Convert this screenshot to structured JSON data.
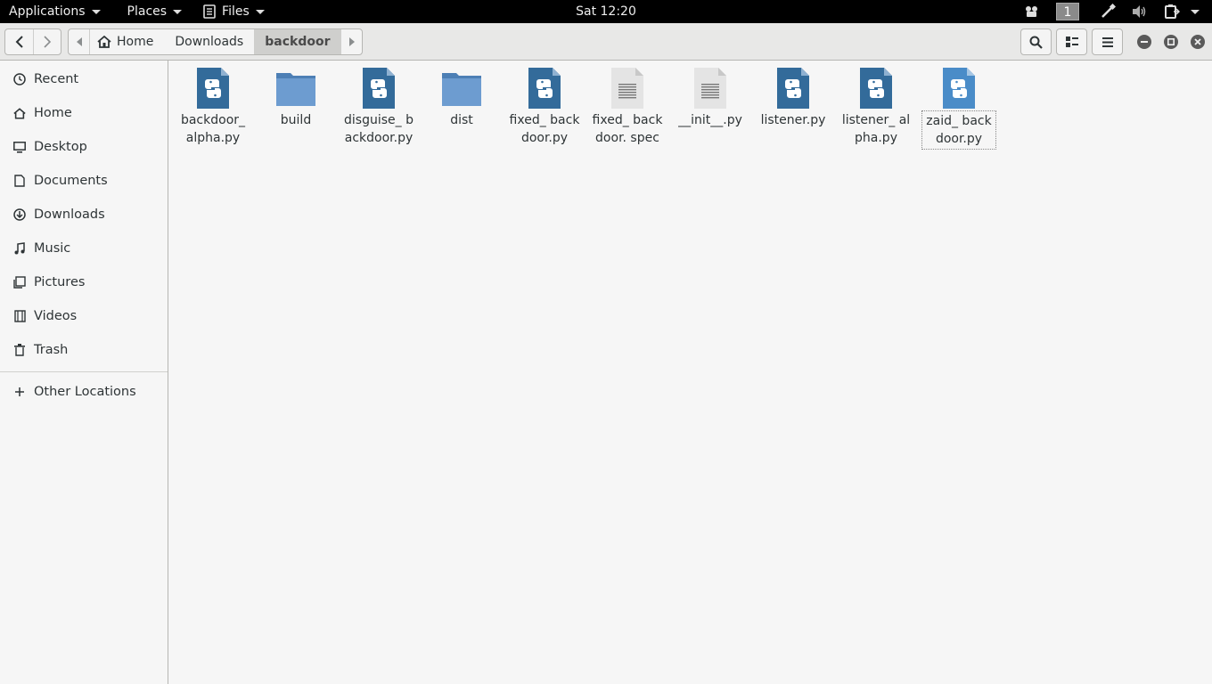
{
  "topbar": {
    "applications": "Applications",
    "places": "Places",
    "files": "Files",
    "clock": "Sat 12:20",
    "workspace": "1"
  },
  "path": {
    "home": "Home",
    "downloads": "Downloads",
    "current": "backdoor"
  },
  "sidebar": {
    "items": [
      {
        "label": "Recent",
        "icon": "clock-icon"
      },
      {
        "label": "Home",
        "icon": "home-icon"
      },
      {
        "label": "Desktop",
        "icon": "desktop-icon"
      },
      {
        "label": "Documents",
        "icon": "document-icon"
      },
      {
        "label": "Downloads",
        "icon": "download-icon"
      },
      {
        "label": "Music",
        "icon": "music-icon"
      },
      {
        "label": "Pictures",
        "icon": "pictures-icon"
      },
      {
        "label": "Videos",
        "icon": "video-icon"
      },
      {
        "label": "Trash",
        "icon": "trash-icon"
      }
    ],
    "other": "Other Locations"
  },
  "files": [
    {
      "name": "backdoor_ alpha.py",
      "type": "python"
    },
    {
      "name": "build",
      "type": "folder"
    },
    {
      "name": "disguise_ backdoor.py",
      "type": "python"
    },
    {
      "name": "dist",
      "type": "folder"
    },
    {
      "name": "fixed_ backdoor.py",
      "type": "python"
    },
    {
      "name": "fixed_ backdoor. spec",
      "type": "text"
    },
    {
      "name": "__init__.py",
      "type": "text"
    },
    {
      "name": "listener.py",
      "type": "python"
    },
    {
      "name": "listener_ alpha.py",
      "type": "python"
    },
    {
      "name": "zaid_ backdoor.py",
      "type": "python-light"
    }
  ],
  "colors": {
    "python_icon": "#336b9a",
    "python_icon_light": "#4a8cc8",
    "folder": "#6d9cd0",
    "text_icon": "#e4e4e4"
  }
}
